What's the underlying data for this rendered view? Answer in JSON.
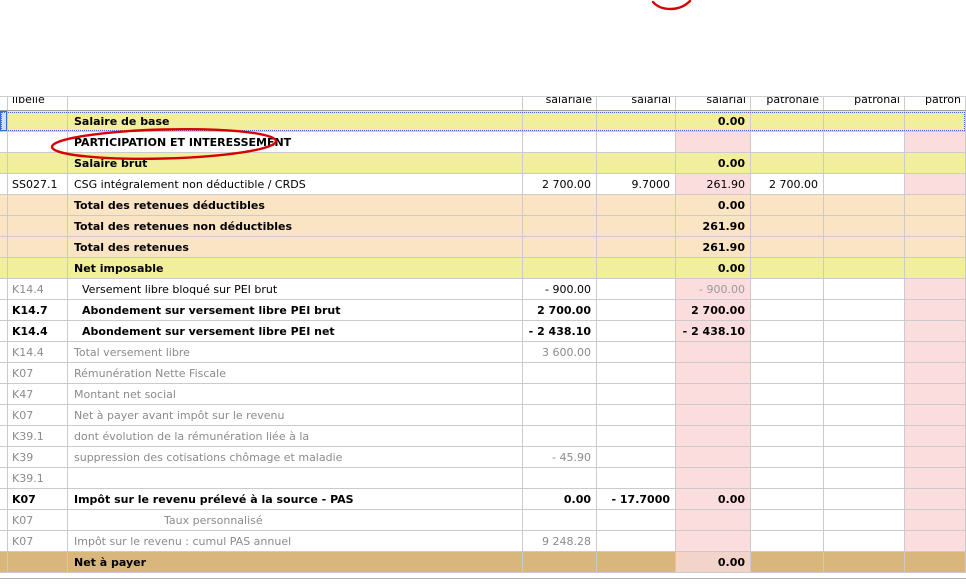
{
  "header": {
    "code_col": "libellé",
    "cols": [
      "salariale",
      "salarial",
      "salarial",
      "patronale",
      "patronal",
      "patron"
    ]
  },
  "rows": [
    {
      "code": "",
      "label": "Salaire de base",
      "cells": [
        "",
        "",
        "0.00",
        "",
        "",
        ""
      ]
    },
    {
      "code": "",
      "label": "PARTICIPATION ET INTERESSEMENT",
      "cells": [
        "",
        "",
        "",
        "",
        "",
        ""
      ]
    },
    {
      "code": "",
      "label": "Salaire brut",
      "cells": [
        "",
        "",
        "0.00",
        "",
        "",
        ""
      ]
    },
    {
      "code": "SS027.1",
      "label": "CSG intégralement non déductible / CRDS",
      "cells": [
        "2 700.00",
        "9.7000",
        "261.90",
        "2 700.00",
        "",
        ""
      ]
    },
    {
      "code": "",
      "label": "Total des retenues déductibles",
      "cells": [
        "",
        "",
        "0.00",
        "",
        "",
        ""
      ]
    },
    {
      "code": "",
      "label": "Total des retenues non déductibles",
      "cells": [
        "",
        "",
        "261.90",
        "",
        "",
        ""
      ]
    },
    {
      "code": "",
      "label": "Total des retenues",
      "cells": [
        "",
        "",
        "261.90",
        "",
        "",
        ""
      ]
    },
    {
      "code": "",
      "label": "Net imposable",
      "cells": [
        "",
        "",
        "0.00",
        "",
        "",
        ""
      ]
    },
    {
      "code": "K14.4",
      "label": "Versement libre bloqué sur PEI brut",
      "cells": [
        "- 900.00",
        "",
        "- 900.00",
        "",
        "",
        ""
      ]
    },
    {
      "code": "K14.7",
      "label": "Abondement sur versement libre PEI brut",
      "cells": [
        "2 700.00",
        "",
        "2 700.00",
        "",
        "",
        ""
      ]
    },
    {
      "code": "K14.4",
      "label": "Abondement sur versement libre PEI net",
      "cells": [
        "- 2 438.10",
        "",
        "- 2 438.10",
        "",
        "",
        ""
      ]
    },
    {
      "code": "K14.4",
      "label": "Total versement libre",
      "cells": [
        "3 600.00",
        "",
        "",
        "",
        "",
        ""
      ]
    },
    {
      "code": "K07",
      "label": "Rémunération Nette Fiscale",
      "cells": [
        "",
        "",
        "",
        "",
        "",
        ""
      ]
    },
    {
      "code": "K47",
      "label": "Montant net social",
      "cells": [
        "",
        "",
        "",
        "",
        "",
        ""
      ]
    },
    {
      "code": "K07",
      "label": "Net à payer avant impôt sur le revenu",
      "cells": [
        "",
        "",
        "",
        "",
        "",
        ""
      ]
    },
    {
      "code": "K39.1",
      "label": "dont évolution de la rémunération liée à la",
      "cells": [
        "",
        "",
        "",
        "",
        "",
        ""
      ]
    },
    {
      "code": "K39",
      "label": "suppression des cotisations chômage et maladie",
      "cells": [
        "- 45.90",
        "",
        "",
        "",
        "",
        ""
      ]
    },
    {
      "code": "K39.1",
      "label": "",
      "cells": [
        "",
        "",
        "",
        "",
        "",
        ""
      ]
    },
    {
      "code": "K07",
      "label": "Impôt sur le revenu prélevé à la source - PAS",
      "cells": [
        "0.00",
        "- 17.7000",
        "0.00",
        "",
        "",
        ""
      ]
    },
    {
      "code": "K07",
      "label": "Taux personnalisé",
      "cells": [
        "",
        "",
        "",
        "",
        "",
        ""
      ]
    },
    {
      "code": "K07",
      "label": "Impôt sur le revenu : cumul PAS annuel",
      "cells": [
        "9 248.28",
        "",
        "",
        "",
        "",
        ""
      ]
    },
    {
      "code": "",
      "label": "Net à payer",
      "cells": [
        "",
        "",
        "0.00",
        "",
        "",
        ""
      ]
    }
  ],
  "annotations": {
    "circle_target": "PARTICIPATION ET INTERESSEMENT",
    "pen_color": "#d40404"
  },
  "colors": {
    "row_yellow": "#f1ef9e",
    "row_peach": "#fbe4c3",
    "row_tan": "#d9b67b",
    "cell_pink": "#fbdddd",
    "selection_blue": "#3b6ad4",
    "grid_line": "#cbcbcb"
  }
}
